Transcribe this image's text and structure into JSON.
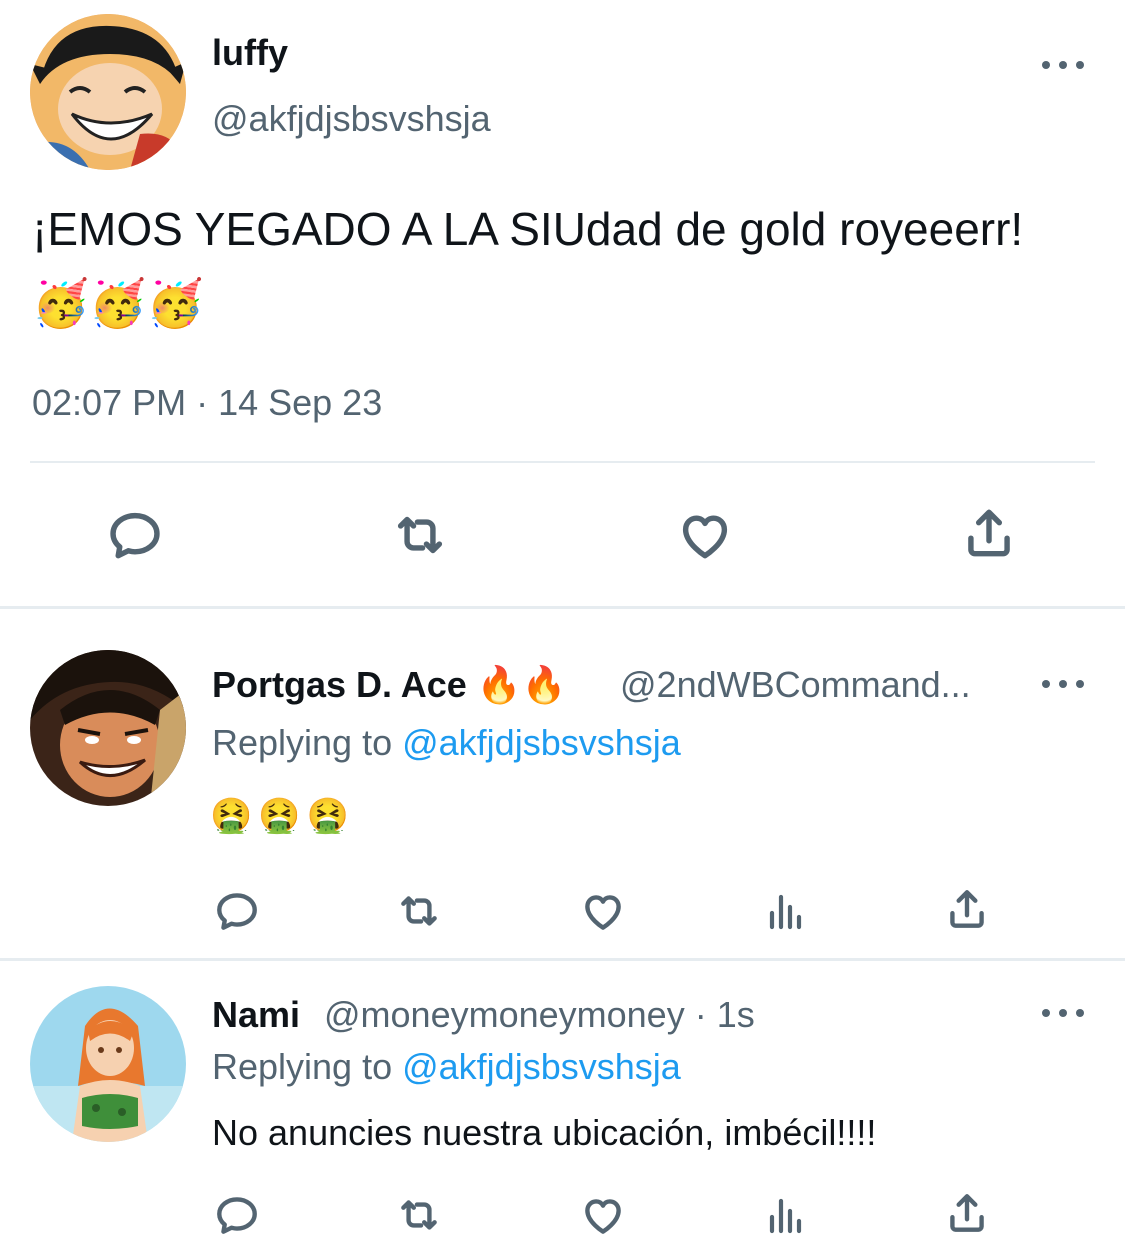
{
  "main_tweet": {
    "author_name": "luffy",
    "author_handle": "@akfjdjsbsvshsja",
    "text": "¡EMOS YEGADO A LA SIUdad de gold royeeerr! 🥳🥳🥳",
    "timestamp": "02:07 PM · 14 Sep 23",
    "avatar_icon": "luffy-avatar-icon"
  },
  "replies": [
    {
      "author_name": "Portgas D. Ace 🔥🔥",
      "author_handle": "@2ndWBCommand...",
      "replying_prefix": "Replying to ",
      "replying_to": "@akfjdjsbsvshsja",
      "text": "🤮🤮🤮",
      "avatar_icon": "ace-avatar-icon"
    },
    {
      "author_name": "Nami",
      "author_handle": "@moneymoneymoney · 1s",
      "replying_prefix": "Replying to ",
      "replying_to": "@akfjdjsbsvshsja",
      "text": "No anuncies nuestra ubicación, imbécil!!!!",
      "avatar_icon": "nami-avatar-icon"
    }
  ],
  "colors": {
    "text_primary": "#0f1419",
    "text_secondary": "#536471",
    "link": "#1d9bf0",
    "divider": "#e6ecf0"
  },
  "icons": [
    "reply-icon",
    "retweet-icon",
    "like-icon",
    "share-icon",
    "views-icon",
    "more-icon"
  ]
}
